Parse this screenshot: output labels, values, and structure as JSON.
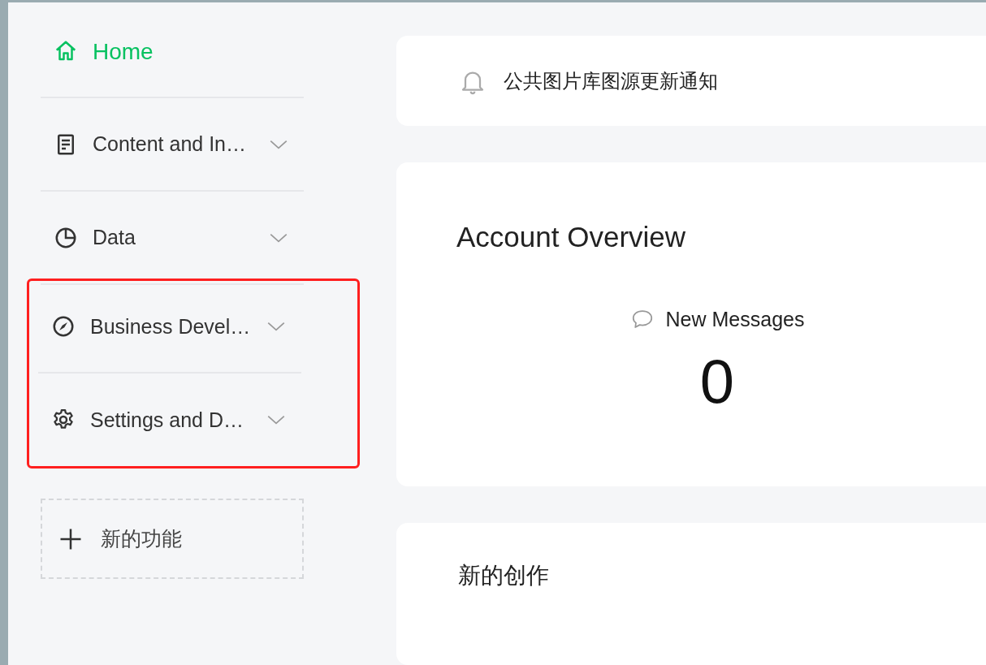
{
  "sidebar": {
    "items": [
      {
        "kind": "home",
        "label": "Home",
        "selected": true,
        "expandable": false,
        "highlighted": false
      },
      {
        "kind": "document",
        "label": "Content and In…",
        "selected": false,
        "expandable": true,
        "highlighted": false
      },
      {
        "kind": "chart",
        "label": "Data",
        "selected": false,
        "expandable": true,
        "highlighted": false
      },
      {
        "kind": "compass",
        "label": "Business Devel…",
        "selected": false,
        "expandable": true,
        "highlighted": true
      },
      {
        "kind": "gear",
        "label": "Settings and D…",
        "selected": false,
        "expandable": true,
        "highlighted": true
      }
    ],
    "add_button": {
      "label": "新的功能"
    }
  },
  "notice": {
    "text": "公共图片库图源更新通知"
  },
  "overview": {
    "title": "Account Overview",
    "stats": [
      {
        "label": "New Messages",
        "value": "0"
      }
    ]
  },
  "creation": {
    "title": "新的创作"
  }
}
